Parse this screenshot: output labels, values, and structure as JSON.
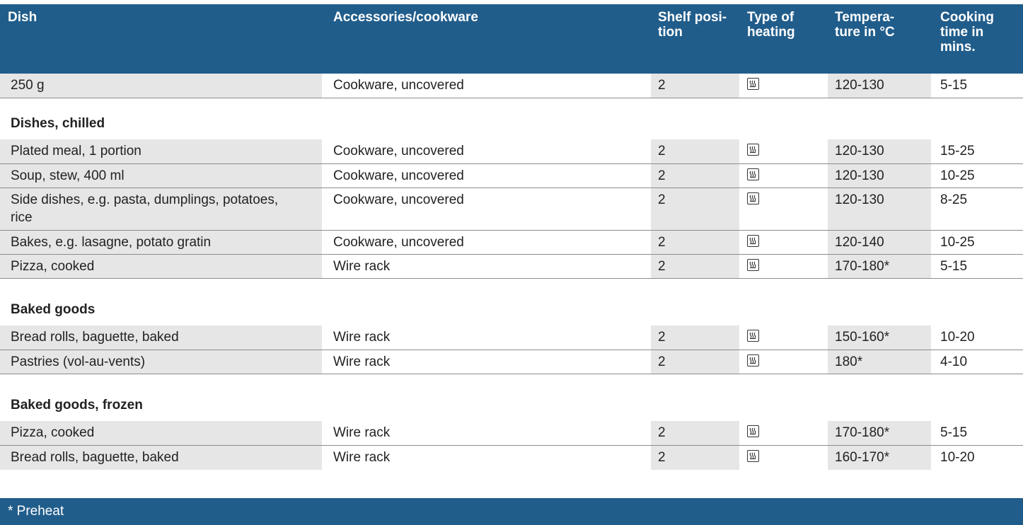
{
  "header": {
    "dish": "Dish",
    "accessories": "Accessories/cookware",
    "shelf_line1": "Shelf posi-",
    "shelf_line2": "tion",
    "heating_line1": "Type of",
    "heating_line2": "heating",
    "temp_line1": "Tempera-",
    "temp_line2": "ture in °C",
    "time_line1": "Cooking",
    "time_line2": "time in",
    "time_line3": "mins."
  },
  "sections": {
    "dishes_chilled": "Dishes, chilled",
    "baked_goods": "Baked goods",
    "baked_goods_frozen": "Baked goods, frozen"
  },
  "heating_icon": "steam-heating-icon",
  "rows": [
    {
      "dish": "250 g",
      "accessories": "Cookware, uncovered",
      "shelf": "2",
      "temp": "120-130",
      "time": "5-15"
    },
    {
      "dish": "Plated meal, 1 portion",
      "accessories": "Cookware, uncovered",
      "shelf": "2",
      "temp": "120-130",
      "time": "15-25"
    },
    {
      "dish": "Soup, stew, 400 ml",
      "accessories": "Cookware, uncovered",
      "shelf": "2",
      "temp": "120-130",
      "time": "10-25"
    },
    {
      "dish_line1": "Side dishes, e.g. pasta, dumplings, potatoes,",
      "dish_line2": "rice",
      "accessories": "Cookware, uncovered",
      "shelf": "2",
      "temp": "120-130",
      "time": "8-25"
    },
    {
      "dish": "Bakes, e.g. lasagne, potato gratin",
      "accessories": "Cookware, uncovered",
      "shelf": "2",
      "temp": "120-140",
      "time": "10-25"
    },
    {
      "dish": "Pizza, cooked",
      "accessories": "Wire rack",
      "shelf": "2",
      "temp": "170-180*",
      "time": "5-15"
    },
    {
      "dish": "Bread rolls, baguette, baked",
      "accessories": "Wire rack",
      "shelf": "2",
      "temp": "150-160*",
      "time": "10-20"
    },
    {
      "dish": "Pastries (vol-au-vents)",
      "accessories": "Wire rack",
      "shelf": "2",
      "temp": "180*",
      "time": "4-10"
    },
    {
      "dish": "Pizza, cooked",
      "accessories": "Wire rack",
      "shelf": "2",
      "temp": "170-180*",
      "time": "5-15"
    },
    {
      "dish": "Bread rolls, baguette, baked",
      "accessories": "Wire rack",
      "shelf": "2",
      "temp": "160-170*",
      "time": "10-20"
    }
  ],
  "footer": {
    "note": "* Preheat"
  }
}
